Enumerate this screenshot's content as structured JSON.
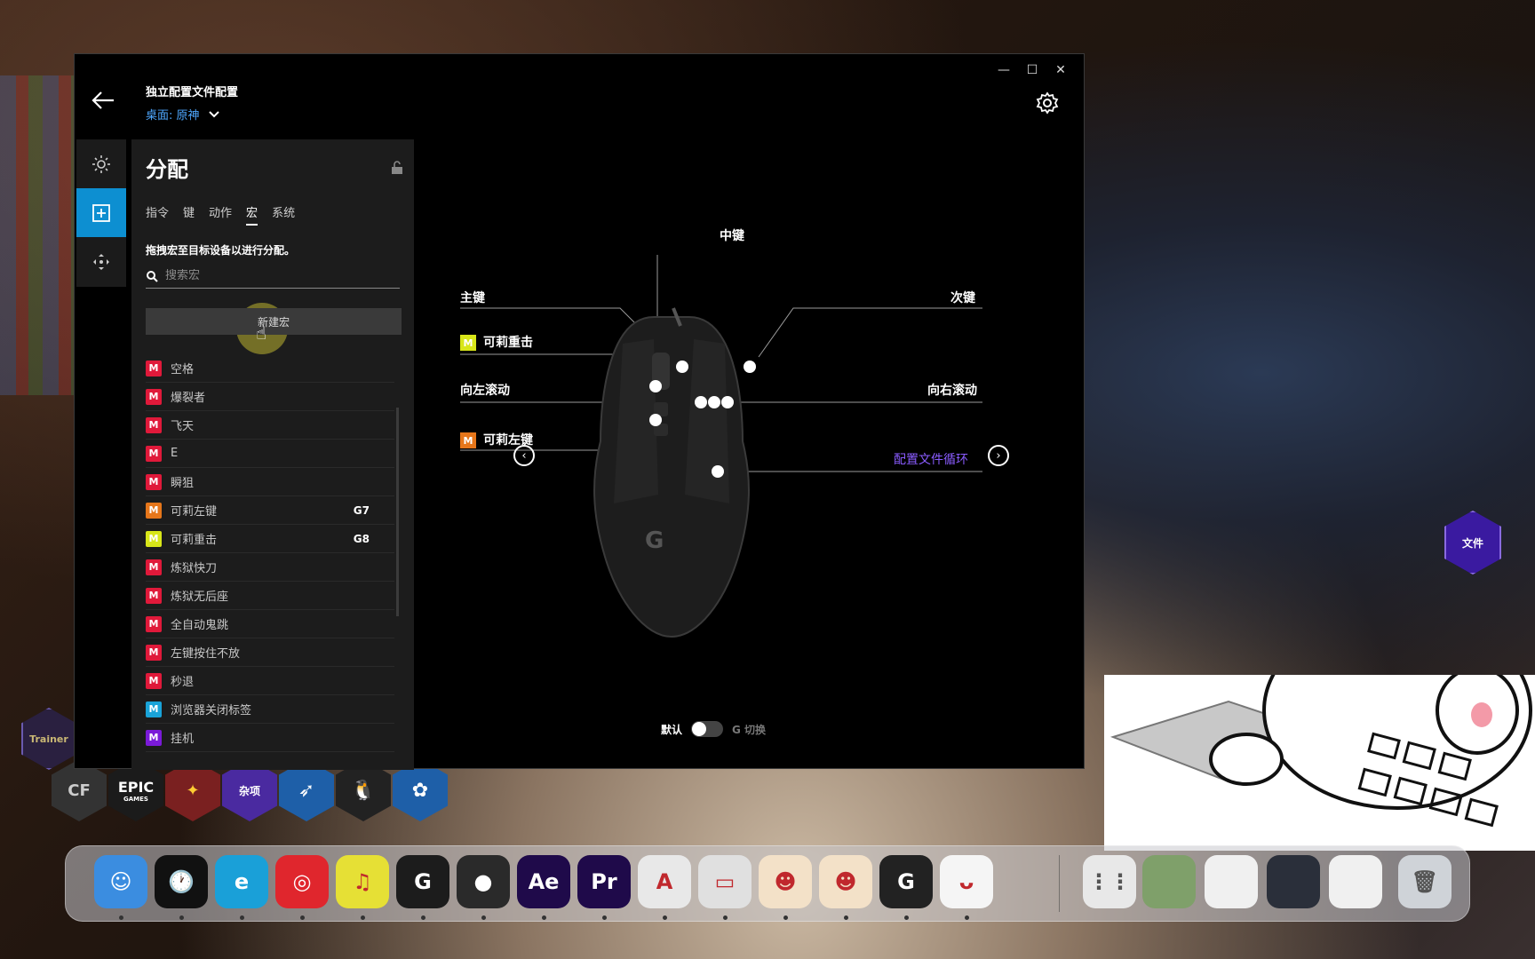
{
  "window": {
    "profile_title": "独立配置文件配置",
    "profile_sub": "桌面: 原神",
    "controls": [
      "—",
      "☐",
      "✕"
    ]
  },
  "panel": {
    "title": "分配",
    "tabs": [
      "指令",
      "键",
      "动作",
      "宏",
      "系统"
    ],
    "active_tab": "宏",
    "hint": "拖拽宏至目标设备以进行分配。",
    "search_placeholder": "搜索宏",
    "new_macro_label": "新建宏",
    "macros": [
      {
        "name": "空格",
        "color": "#e0193a",
        "gkey": ""
      },
      {
        "name": "爆裂者",
        "color": "#e0193a",
        "gkey": ""
      },
      {
        "name": "飞天",
        "color": "#e0193a",
        "gkey": ""
      },
      {
        "name": "E",
        "color": "#e0193a",
        "gkey": ""
      },
      {
        "name": "瞬狙",
        "color": "#e0193a",
        "gkey": ""
      },
      {
        "name": "可莉左键",
        "color": "#e6761a",
        "gkey": "G7"
      },
      {
        "name": "可莉重击",
        "color": "#d8e619",
        "gkey": "G8"
      },
      {
        "name": "炼狱快刀",
        "color": "#e0193a",
        "gkey": ""
      },
      {
        "name": "炼狱无后座",
        "color": "#e0193a",
        "gkey": ""
      },
      {
        "name": "全自动鬼跳",
        "color": "#e0193a",
        "gkey": ""
      },
      {
        "name": "左键按住不放",
        "color": "#e0193a",
        "gkey": ""
      },
      {
        "name": "秒退",
        "color": "#e0193a",
        "gkey": ""
      },
      {
        "name": "浏览器关闭标签",
        "color": "#19a3d8",
        "gkey": ""
      },
      {
        "name": "挂机",
        "color": "#7a1ad8",
        "gkey": ""
      }
    ],
    "macro_badge": "M"
  },
  "mouse": {
    "middle": "中键",
    "primary": "主键",
    "secondary": "次键",
    "g8_label": "可莉重击",
    "scroll_left": "向左滚动",
    "scroll_right": "向右滚动",
    "g7_label": "可莉左键",
    "profile_cycle": "配置文件循环",
    "default_label": "默认",
    "gshift_label": "G 切换"
  },
  "desktop": {
    "hex_file": "文件",
    "hex_misc": "杂项",
    "hex_epic": "EPIC",
    "hex_epic_sub": "GAMES",
    "hex_cf": "CF",
    "trainer_label": "Trainer"
  },
  "dock": {
    "apps": [
      {
        "name": "finder-icon",
        "label": "☺",
        "color": "#3b8de0"
      },
      {
        "name": "clock-icon",
        "label": "🕐",
        "color": "#111111"
      },
      {
        "name": "edge-icon",
        "label": "e",
        "color": "#1aa0d8"
      },
      {
        "name": "netease-music-icon",
        "label": "◎",
        "color": "#e0262d"
      },
      {
        "name": "qq-music-icon",
        "label": "♫",
        "color": "#e6e035"
      },
      {
        "name": "game-icon",
        "label": "G",
        "color": "#1c1c1c"
      },
      {
        "name": "record-icon",
        "label": "●",
        "color": "#2a2a2a"
      },
      {
        "name": "after-effects-icon",
        "label": "Ae",
        "color": "#1f0a4a"
      },
      {
        "name": "premiere-icon",
        "label": "Pr",
        "color": "#1f0a4a"
      },
      {
        "name": "autocad-icon",
        "label": "A",
        "color": "#e8e8e8"
      },
      {
        "name": "window-icon",
        "label": "▭",
        "color": "#e0e0e0"
      },
      {
        "name": "anime-app-icon-1",
        "label": "☻",
        "color": "#f3e1c8"
      },
      {
        "name": "anime-app-icon-2",
        "label": "☻",
        "color": "#f3e1c8"
      },
      {
        "name": "logitech-g-icon",
        "label": "G",
        "color": "#222222"
      },
      {
        "name": "bongo-cat-icon",
        "label": "ᴗ",
        "color": "#f5f5f5"
      }
    ]
  }
}
